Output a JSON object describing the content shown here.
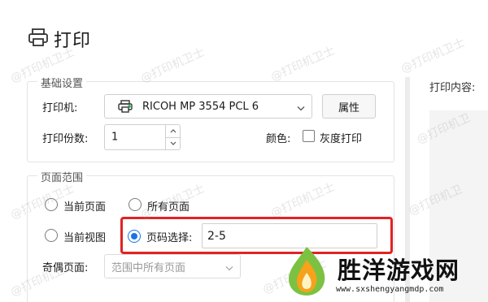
{
  "window": {
    "title": "打印"
  },
  "basic": {
    "group_title": "基础设置",
    "printer_label": "打印机:",
    "printer_value": "RICOH MP 3554 PCL 6",
    "properties_button": "属性",
    "copies_label": "打印份数:",
    "copies_value": "1",
    "color_label": "颜色:",
    "grayscale_label": "灰度打印"
  },
  "page_range": {
    "group_title": "页面范围",
    "current_page": "当前页面",
    "all_pages": "所有页面",
    "current_view": "当前视图",
    "page_select": "页码选择:",
    "page_select_value": "2-5",
    "odd_even_label": "奇偶页面:",
    "odd_even_value": "范围中所有页面",
    "selected_option": "page_select"
  },
  "preview": {
    "label": "打印内容:"
  },
  "watermark": {
    "text": "@打印机卫士",
    "text_short": "@打印机卫"
  },
  "branding": {
    "site_name": "胜洋游戏网",
    "site_url": "www.sxshengyangmdp.com"
  },
  "colors": {
    "accent": "#1a73e8",
    "highlight": "#e02323",
    "logo_green": "#7cc242",
    "logo_orange": "#f6a21b"
  }
}
